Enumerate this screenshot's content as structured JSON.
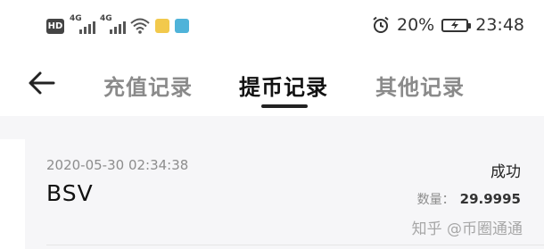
{
  "status_bar": {
    "hd": "HD",
    "network1": "4G",
    "network2": "4G",
    "battery_percent": "20%",
    "time": "23:48"
  },
  "nav": {
    "tabs": [
      {
        "label": "充值记录",
        "active": false
      },
      {
        "label": "提币记录",
        "active": true
      },
      {
        "label": "其他记录",
        "active": false
      }
    ]
  },
  "record": {
    "time": "2020-05-30 02:34:38",
    "coin": "BSV",
    "status": "成功",
    "qty_label": "数量：",
    "qty_value": "29.9995"
  },
  "watermark": "知乎 @币圈通通"
}
